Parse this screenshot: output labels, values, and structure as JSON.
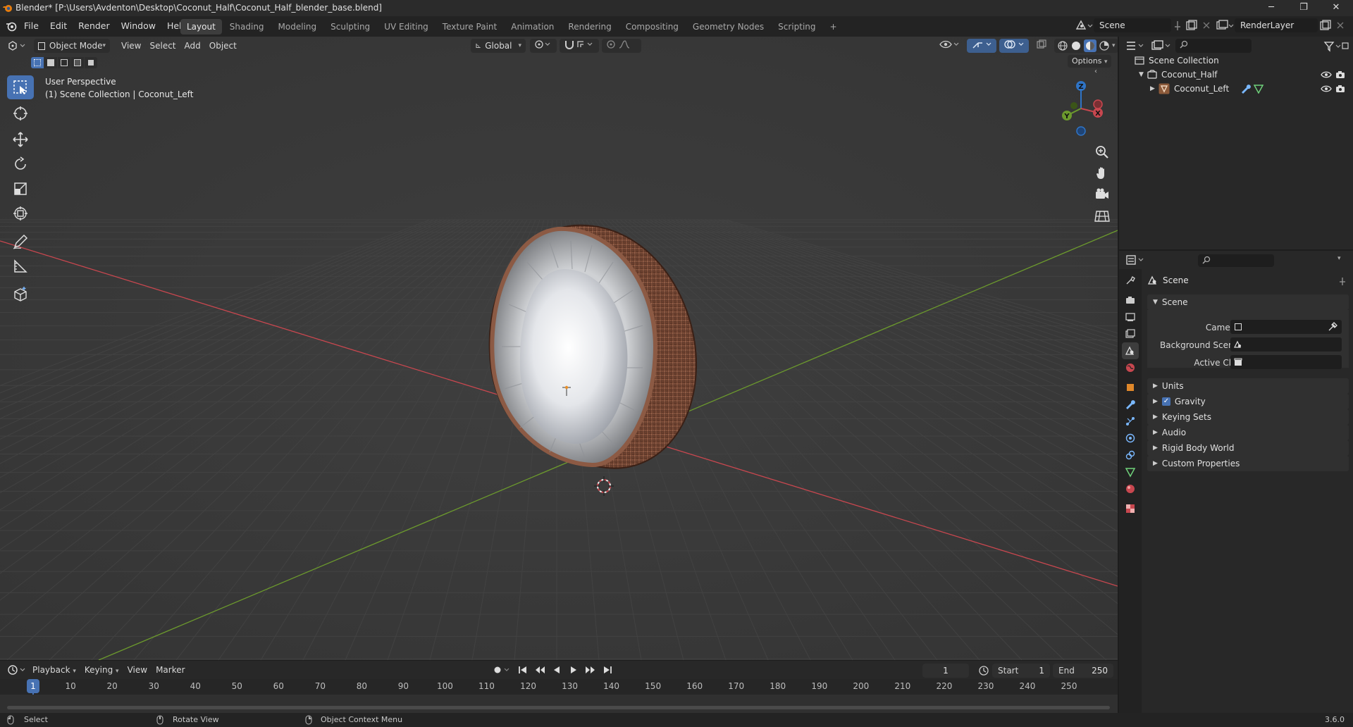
{
  "window": {
    "title": "Blender* [P:\\Users\\Avdenton\\Desktop\\Coconut_Half\\Coconut_Half_blender_base.blend]",
    "minimize": "─",
    "maximize": "❐",
    "close": "✕"
  },
  "menus": [
    "File",
    "Edit",
    "Render",
    "Window",
    "Help"
  ],
  "workspaces": [
    "Layout",
    "Shading",
    "Modeling",
    "Sculpting",
    "UV Editing",
    "Texture Paint",
    "Animation",
    "Rendering",
    "Compositing",
    "Geometry Nodes",
    "Scripting"
  ],
  "workspace_add": "+",
  "active_workspace": "Layout",
  "scene_selector": {
    "value": "Scene"
  },
  "view_layer_selector": {
    "value": "RenderLayer"
  },
  "viewport_header": {
    "mode": "Object Mode",
    "menus": [
      "View",
      "Select",
      "Add",
      "Object"
    ],
    "orientation": "Global",
    "options": "Options"
  },
  "viewport_overlay": {
    "perspective": "User Perspective",
    "collection": "(1) Scene Collection | Coconut_Left"
  },
  "gizmo": {
    "z": "Z",
    "y": "Y",
    "x": "X"
  },
  "outliner": {
    "root": "Scene Collection",
    "items": [
      {
        "label": "Coconut_Half",
        "type": "collection"
      },
      {
        "label": "Coconut_Left",
        "type": "mesh-object"
      }
    ]
  },
  "properties": {
    "header": "Scene",
    "section": "Scene",
    "fields": [
      {
        "label": "Camera"
      },
      {
        "label": "Background Scene"
      },
      {
        "label": "Active Clip"
      }
    ],
    "panels": [
      "Units",
      "Gravity",
      "Keying Sets",
      "Audio",
      "Rigid Body World",
      "Custom Properties"
    ],
    "gravity_checked": true
  },
  "timeline": {
    "menus": [
      "Playback",
      "Keying",
      "View",
      "Marker"
    ],
    "current_frame": "1",
    "start_label": "Start",
    "start": "1",
    "end_label": "End",
    "end": "250",
    "ticks": [
      "1",
      "10",
      "20",
      "30",
      "40",
      "50",
      "60",
      "70",
      "80",
      "90",
      "100",
      "110",
      "120",
      "130",
      "140",
      "150",
      "160",
      "170",
      "180",
      "190",
      "200",
      "210",
      "220",
      "230",
      "240",
      "250"
    ]
  },
  "statusbar": {
    "select": "Select",
    "rotate": "Rotate View",
    "context": "Object Context Menu",
    "version": "3.6.0"
  },
  "colors": {
    "accent": "#4772b3",
    "x_axis": "#c8474f",
    "y_axis": "#6c9a2d",
    "z_axis": "#2f74c6"
  }
}
